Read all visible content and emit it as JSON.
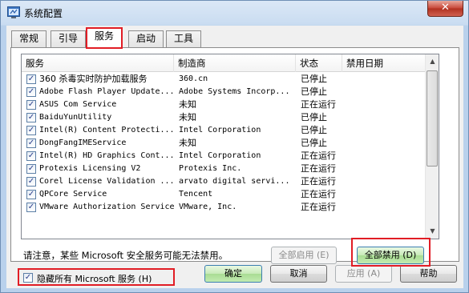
{
  "window": {
    "title": "系统配置",
    "close_label": "✕"
  },
  "tabs": [
    {
      "label": "常规"
    },
    {
      "label": "引导"
    },
    {
      "label": "服务"
    },
    {
      "label": "启动"
    },
    {
      "label": "工具"
    }
  ],
  "columns": {
    "service": "服务",
    "manufacturer": "制造商",
    "status": "状态",
    "disabled_date": "禁用日期"
  },
  "rows": [
    {
      "name": "360 杀毒实时防护加载服务",
      "mfr": "360.cn",
      "status": "已停止",
      "checked": true
    },
    {
      "name": "Adobe Flash Player Update...",
      "mfr": "Adobe Systems Incorp...",
      "status": "已停止",
      "checked": true
    },
    {
      "name": "ASUS Com Service",
      "mfr": "未知",
      "status": "正在运行",
      "checked": true
    },
    {
      "name": "BaiduYunUtility",
      "mfr": "未知",
      "status": "已停止",
      "checked": true
    },
    {
      "name": "Intel(R) Content Protecti...",
      "mfr": "Intel Corporation",
      "status": "已停止",
      "checked": true
    },
    {
      "name": "DongFangIMEService",
      "mfr": "未知",
      "status": "已停止",
      "checked": true
    },
    {
      "name": "Intel(R) HD Graphics Cont...",
      "mfr": "Intel Corporation",
      "status": "正在运行",
      "checked": true
    },
    {
      "name": "Protexis Licensing V2",
      "mfr": "Protexis Inc.",
      "status": "正在运行",
      "checked": true
    },
    {
      "name": "Corel License Validation ...",
      "mfr": "arvato digital servi...",
      "status": "正在运行",
      "checked": true
    },
    {
      "name": "QPCore Service",
      "mfr": "Tencent",
      "status": "正在运行",
      "checked": true
    },
    {
      "name": "VMware Authorization Service",
      "mfr": "VMware, Inc.",
      "status": "正在运行",
      "checked": true
    }
  ],
  "note": "请注意，某些 Microsoft 安全服务可能无法禁用。",
  "buttons": {
    "enable_all": "全部启用 (E)",
    "disable_all": "全部禁用 (D)",
    "ok": "确定",
    "cancel": "取消",
    "apply": "应用 (A)",
    "help": "帮助"
  },
  "hide_ms": {
    "label": "隐藏所有 Microsoft 服务 (H)",
    "checked": true
  },
  "colors": {
    "highlight": "#e11d25",
    "accent_green": "#a9dc93"
  }
}
